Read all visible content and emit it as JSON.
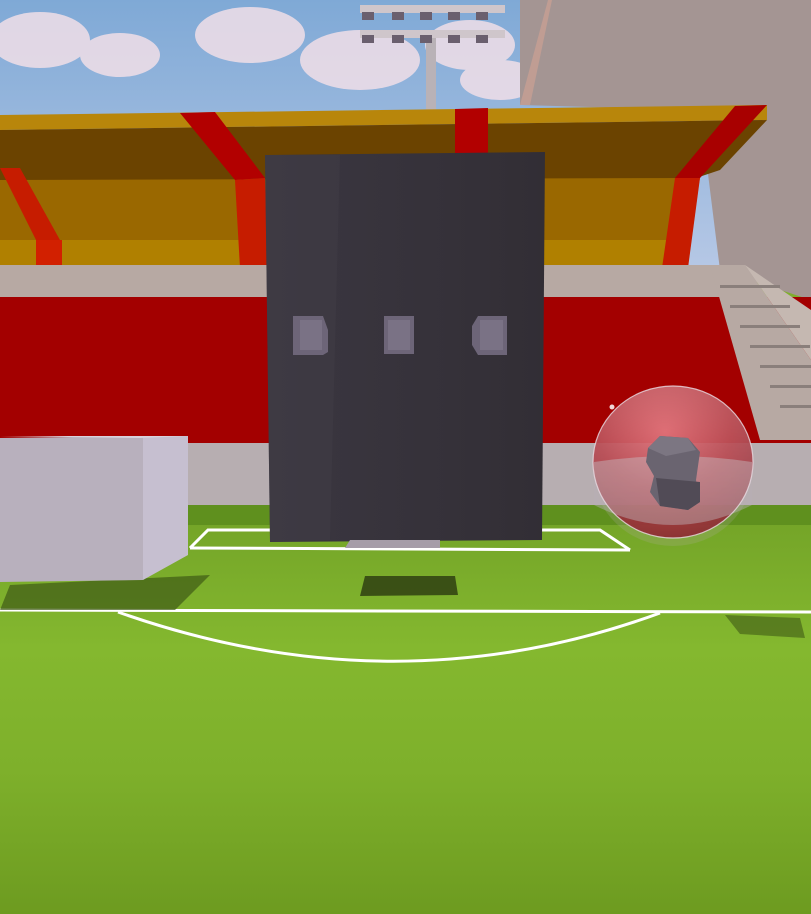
{
  "scene": {
    "type": "3d-stadium-game-view",
    "colors": {
      "sky": "#8fb3d9",
      "cloud": "#e9d9e2",
      "roof_gold": "#b8860b",
      "roof_dark": "#6b3f00",
      "roof_red": "#b20000",
      "stand_red": "#a30000",
      "stand_trim": "#b7a9a3",
      "wall_beige": "#a49593",
      "grass_light": "#86b830",
      "grass_dark": "#6f9d22",
      "field_line": "#ffffff",
      "wall_panel": "#363239",
      "wall_button": "#6d6578",
      "crate": "#b8b0bd",
      "sphere_red": "#b0262f",
      "rock": "#5f5a63"
    },
    "objects": [
      "floodlight-tower",
      "stadium-roof",
      "red-stands",
      "stairs",
      "dark-wall-panel",
      "white-crate",
      "red-bubble-sphere",
      "rock-inside-sphere",
      "soccer-field"
    ]
  }
}
